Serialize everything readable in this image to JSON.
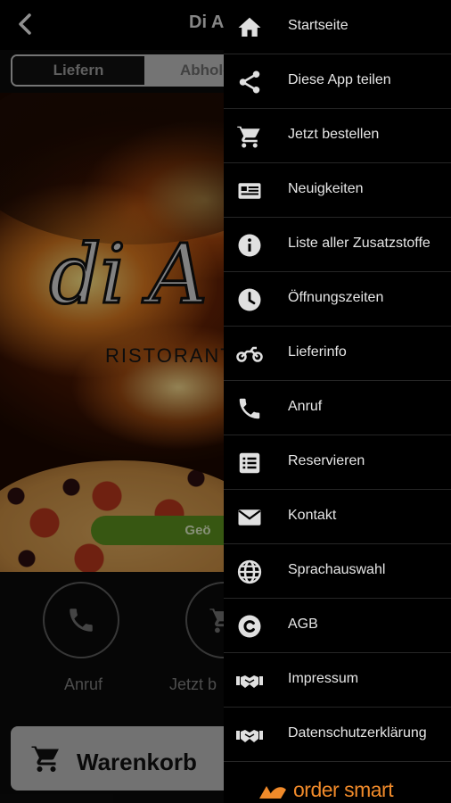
{
  "app": {
    "title": "Di A",
    "mode_options": [
      "Liefern",
      "Abholen"
    ],
    "logo_text": "di A",
    "subtitle": "RISTORANTE",
    "open_status": "Geö",
    "actions": [
      {
        "label": "Anruf",
        "icon": "phone-icon"
      },
      {
        "label": "Jetzt b",
        "icon": "cart-icon"
      }
    ],
    "cart_label": "Warenkorb"
  },
  "menu": {
    "items": [
      {
        "label": "Startseite",
        "icon": "home-icon"
      },
      {
        "label": "Diese App teilen",
        "icon": "share-icon"
      },
      {
        "label": "Jetzt bestellen",
        "icon": "cart-icon"
      },
      {
        "label": "Neuigkeiten",
        "icon": "newspaper-icon"
      },
      {
        "label": "Liste aller Zusatzstoffe",
        "icon": "info-icon"
      },
      {
        "label": "Öffnungszeiten",
        "icon": "clock-icon"
      },
      {
        "label": "Lieferinfo",
        "icon": "motorcycle-icon"
      },
      {
        "label": "Anruf",
        "icon": "phone-icon"
      },
      {
        "label": "Reservieren",
        "icon": "list-icon"
      },
      {
        "label": "Kontakt",
        "icon": "envelope-icon"
      },
      {
        "label": "Sprachauswahl",
        "icon": "globe-icon"
      },
      {
        "label": "AGB",
        "icon": "copyright-icon"
      },
      {
        "label": "Impressum",
        "icon": "handshake-icon"
      },
      {
        "label": "Datenschutzerklärung",
        "icon": "handshake-icon"
      }
    ],
    "brand": "order smart"
  },
  "colors": {
    "accent_green": "#5a8d1e",
    "brand_orange": "#f08a2a",
    "drawer_bg": "#000000",
    "menu_text": "#e6e6e6"
  }
}
